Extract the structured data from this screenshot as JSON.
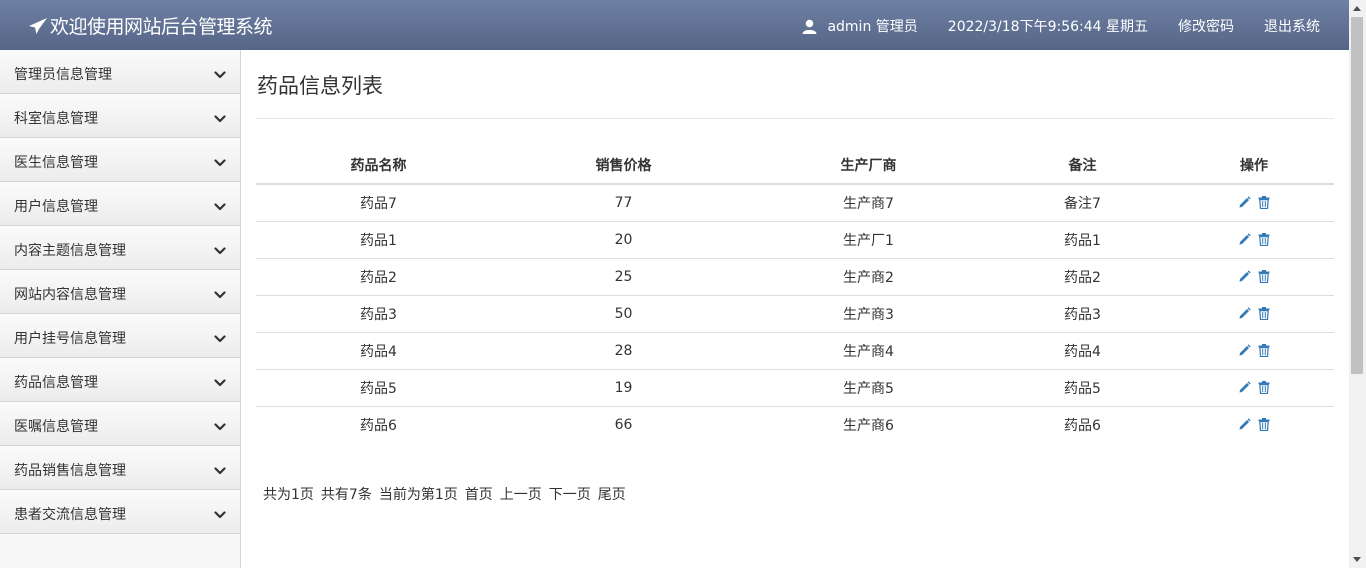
{
  "header": {
    "title": "欢迎使用网站后台管理系统",
    "user": "admin 管理员",
    "datetime": "2022/3/18下午9:56:44 星期五",
    "change_password": "修改密码",
    "logout": "退出系统"
  },
  "sidebar": {
    "items": [
      {
        "label": "管理员信息管理"
      },
      {
        "label": "科室信息管理"
      },
      {
        "label": "医生信息管理"
      },
      {
        "label": "用户信息管理"
      },
      {
        "label": "内容主题信息管理"
      },
      {
        "label": "网站内容信息管理"
      },
      {
        "label": "用户挂号信息管理"
      },
      {
        "label": "药品信息管理"
      },
      {
        "label": "医嘱信息管理"
      },
      {
        "label": "药品销售信息管理"
      },
      {
        "label": "患者交流信息管理"
      }
    ]
  },
  "main": {
    "title": "药品信息列表",
    "table": {
      "headers": [
        "药品名称",
        "销售价格",
        "生产厂商",
        "备注",
        "操作"
      ],
      "rows": [
        [
          "药品7",
          "77",
          "生产商7",
          "备注7"
        ],
        [
          "药品1",
          "20",
          "生产厂1",
          "药品1"
        ],
        [
          "药品2",
          "25",
          "生产商2",
          "药品2"
        ],
        [
          "药品3",
          "50",
          "生产商3",
          "药品3"
        ],
        [
          "药品4",
          "28",
          "生产商4",
          "药品4"
        ],
        [
          "药品5",
          "19",
          "生产商5",
          "药品5"
        ],
        [
          "药品6",
          "66",
          "生产商6",
          "药品6"
        ]
      ]
    },
    "pager": {
      "total_pages": "共为1页",
      "total_records": "共有7条",
      "current": "当前为第1页",
      "first": "首页",
      "prev": "上一页",
      "next": "下一页",
      "last": "尾页"
    }
  },
  "icons": {
    "brand": "paper-plane-icon",
    "user": "user-icon",
    "chevron": "chevron-down-icon",
    "edit": "pencil-icon",
    "delete": "trash-icon"
  },
  "colors": {
    "header_top": "#6e80a4",
    "header_bottom": "#556587",
    "icon_blue": "#337ab7"
  }
}
